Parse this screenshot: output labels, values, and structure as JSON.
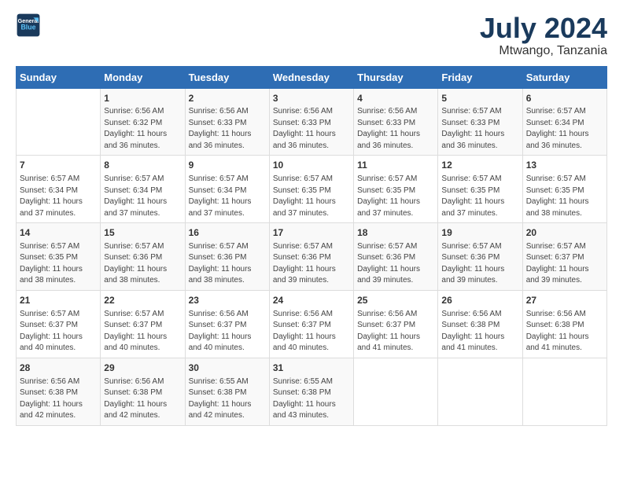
{
  "logo": {
    "line1": "General",
    "line2": "Blue"
  },
  "title": "July 2024",
  "subtitle": "Mtwango, Tanzania",
  "days_header": [
    "Sunday",
    "Monday",
    "Tuesday",
    "Wednesday",
    "Thursday",
    "Friday",
    "Saturday"
  ],
  "weeks": [
    [
      {
        "day": "",
        "content": ""
      },
      {
        "day": "1",
        "content": "Sunrise: 6:56 AM\nSunset: 6:32 PM\nDaylight: 11 hours\nand 36 minutes."
      },
      {
        "day": "2",
        "content": "Sunrise: 6:56 AM\nSunset: 6:33 PM\nDaylight: 11 hours\nand 36 minutes."
      },
      {
        "day": "3",
        "content": "Sunrise: 6:56 AM\nSunset: 6:33 PM\nDaylight: 11 hours\nand 36 minutes."
      },
      {
        "day": "4",
        "content": "Sunrise: 6:56 AM\nSunset: 6:33 PM\nDaylight: 11 hours\nand 36 minutes."
      },
      {
        "day": "5",
        "content": "Sunrise: 6:57 AM\nSunset: 6:33 PM\nDaylight: 11 hours\nand 36 minutes."
      },
      {
        "day": "6",
        "content": "Sunrise: 6:57 AM\nSunset: 6:34 PM\nDaylight: 11 hours\nand 36 minutes."
      }
    ],
    [
      {
        "day": "7",
        "content": "Sunrise: 6:57 AM\nSunset: 6:34 PM\nDaylight: 11 hours\nand 37 minutes."
      },
      {
        "day": "8",
        "content": "Sunrise: 6:57 AM\nSunset: 6:34 PM\nDaylight: 11 hours\nand 37 minutes."
      },
      {
        "day": "9",
        "content": "Sunrise: 6:57 AM\nSunset: 6:34 PM\nDaylight: 11 hours\nand 37 minutes."
      },
      {
        "day": "10",
        "content": "Sunrise: 6:57 AM\nSunset: 6:35 PM\nDaylight: 11 hours\nand 37 minutes."
      },
      {
        "day": "11",
        "content": "Sunrise: 6:57 AM\nSunset: 6:35 PM\nDaylight: 11 hours\nand 37 minutes."
      },
      {
        "day": "12",
        "content": "Sunrise: 6:57 AM\nSunset: 6:35 PM\nDaylight: 11 hours\nand 37 minutes."
      },
      {
        "day": "13",
        "content": "Sunrise: 6:57 AM\nSunset: 6:35 PM\nDaylight: 11 hours\nand 38 minutes."
      }
    ],
    [
      {
        "day": "14",
        "content": "Sunrise: 6:57 AM\nSunset: 6:35 PM\nDaylight: 11 hours\nand 38 minutes."
      },
      {
        "day": "15",
        "content": "Sunrise: 6:57 AM\nSunset: 6:36 PM\nDaylight: 11 hours\nand 38 minutes."
      },
      {
        "day": "16",
        "content": "Sunrise: 6:57 AM\nSunset: 6:36 PM\nDaylight: 11 hours\nand 38 minutes."
      },
      {
        "day": "17",
        "content": "Sunrise: 6:57 AM\nSunset: 6:36 PM\nDaylight: 11 hours\nand 39 minutes."
      },
      {
        "day": "18",
        "content": "Sunrise: 6:57 AM\nSunset: 6:36 PM\nDaylight: 11 hours\nand 39 minutes."
      },
      {
        "day": "19",
        "content": "Sunrise: 6:57 AM\nSunset: 6:36 PM\nDaylight: 11 hours\nand 39 minutes."
      },
      {
        "day": "20",
        "content": "Sunrise: 6:57 AM\nSunset: 6:37 PM\nDaylight: 11 hours\nand 39 minutes."
      }
    ],
    [
      {
        "day": "21",
        "content": "Sunrise: 6:57 AM\nSunset: 6:37 PM\nDaylight: 11 hours\nand 40 minutes."
      },
      {
        "day": "22",
        "content": "Sunrise: 6:57 AM\nSunset: 6:37 PM\nDaylight: 11 hours\nand 40 minutes."
      },
      {
        "day": "23",
        "content": "Sunrise: 6:56 AM\nSunset: 6:37 PM\nDaylight: 11 hours\nand 40 minutes."
      },
      {
        "day": "24",
        "content": "Sunrise: 6:56 AM\nSunset: 6:37 PM\nDaylight: 11 hours\nand 40 minutes."
      },
      {
        "day": "25",
        "content": "Sunrise: 6:56 AM\nSunset: 6:37 PM\nDaylight: 11 hours\nand 41 minutes."
      },
      {
        "day": "26",
        "content": "Sunrise: 6:56 AM\nSunset: 6:38 PM\nDaylight: 11 hours\nand 41 minutes."
      },
      {
        "day": "27",
        "content": "Sunrise: 6:56 AM\nSunset: 6:38 PM\nDaylight: 11 hours\nand 41 minutes."
      }
    ],
    [
      {
        "day": "28",
        "content": "Sunrise: 6:56 AM\nSunset: 6:38 PM\nDaylight: 11 hours\nand 42 minutes."
      },
      {
        "day": "29",
        "content": "Sunrise: 6:56 AM\nSunset: 6:38 PM\nDaylight: 11 hours\nand 42 minutes."
      },
      {
        "day": "30",
        "content": "Sunrise: 6:55 AM\nSunset: 6:38 PM\nDaylight: 11 hours\nand 42 minutes."
      },
      {
        "day": "31",
        "content": "Sunrise: 6:55 AM\nSunset: 6:38 PM\nDaylight: 11 hours\nand 43 minutes."
      },
      {
        "day": "",
        "content": ""
      },
      {
        "day": "",
        "content": ""
      },
      {
        "day": "",
        "content": ""
      }
    ]
  ]
}
